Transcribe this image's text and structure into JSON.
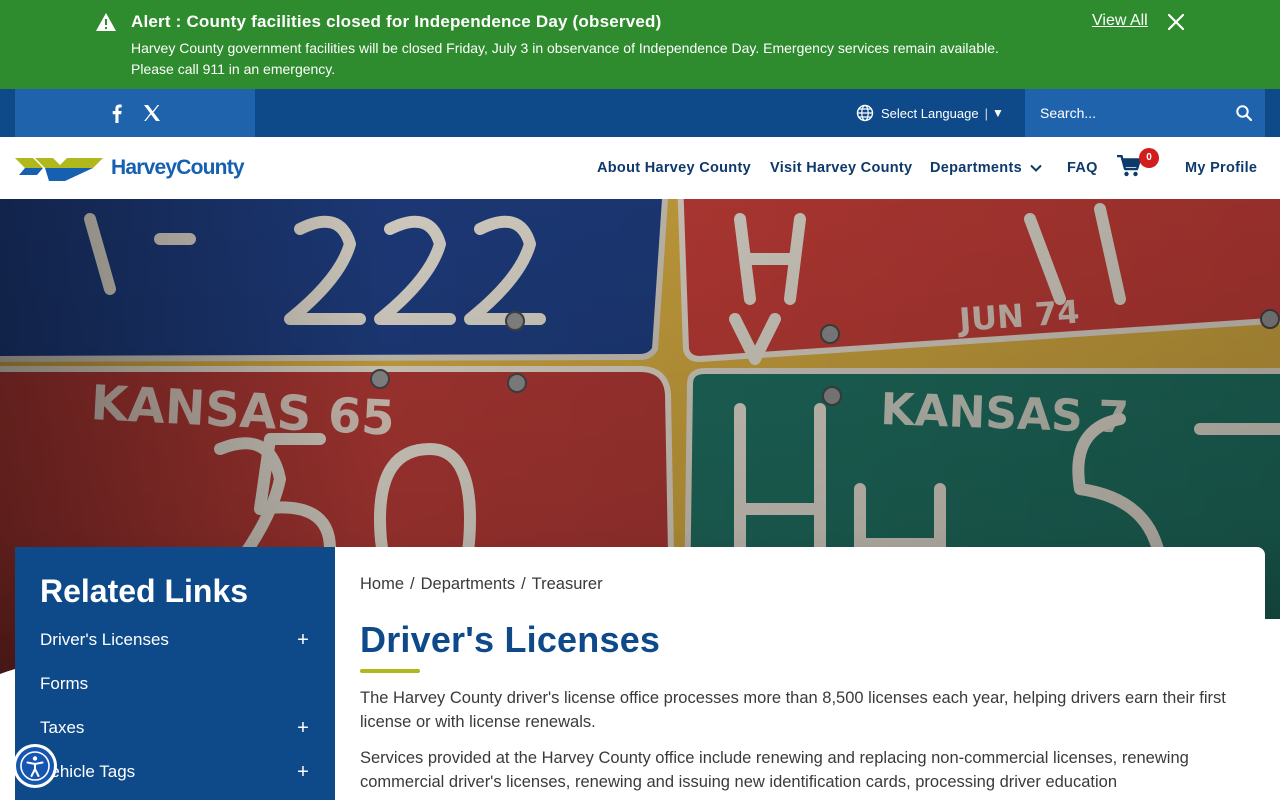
{
  "alert": {
    "title": "Alert : County facilities closed for Independence Day (observed)",
    "body": "Harvey County government facilities will be closed Friday, July 3 in observance of Independence Day. Emergency services remain available. Please call 911 in an emergency.",
    "view_all": "View All",
    "icons": [
      "warning-icon",
      "close-icon"
    ],
    "background": "#2e8b2e"
  },
  "utility": {
    "social_icons": [
      "facebook-icon",
      "x-icon"
    ],
    "language_label": "Select Language",
    "language_separator": "|",
    "language_caret": "▼",
    "search_placeholder": "Search..."
  },
  "header": {
    "logo_text": "HarveyCounty",
    "nav": {
      "about": "About Harvey County",
      "visit": "Visit Harvey County",
      "departments": "Departments",
      "faq": "FAQ",
      "profile": "My Profile"
    },
    "cart_count": "0"
  },
  "sidebar": {
    "title": "Related Links",
    "items": [
      {
        "label": "Driver's Licenses",
        "expand": "+"
      },
      {
        "label": "Forms",
        "expand": ""
      },
      {
        "label": "Taxes",
        "expand": "+"
      },
      {
        "label": "Vehicle Tags",
        "expand": "+"
      }
    ]
  },
  "content": {
    "breadcrumb": {
      "home": "Home",
      "departments": "Departments",
      "treasurer": "Treasurer",
      "separator": "/"
    },
    "title": "Driver's Licenses",
    "paragraphs": [
      "The Harvey County driver's license office processes more than 8,500 licenses each year, helping drivers earn their first license or with license renewals.",
      "Services provided at the Harvey County office include renewing and replacing non-commercial licenses, renewing commercial driver's licenses, renewing and issuing new identification cards, processing driver education"
    ]
  },
  "colors": {
    "primary_blue": "#0e4a8a",
    "secondary_blue": "#1f63ad",
    "accent_green": "#b1b81c",
    "alert_green": "#2e8b2e",
    "badge_red": "#d21d1d"
  }
}
